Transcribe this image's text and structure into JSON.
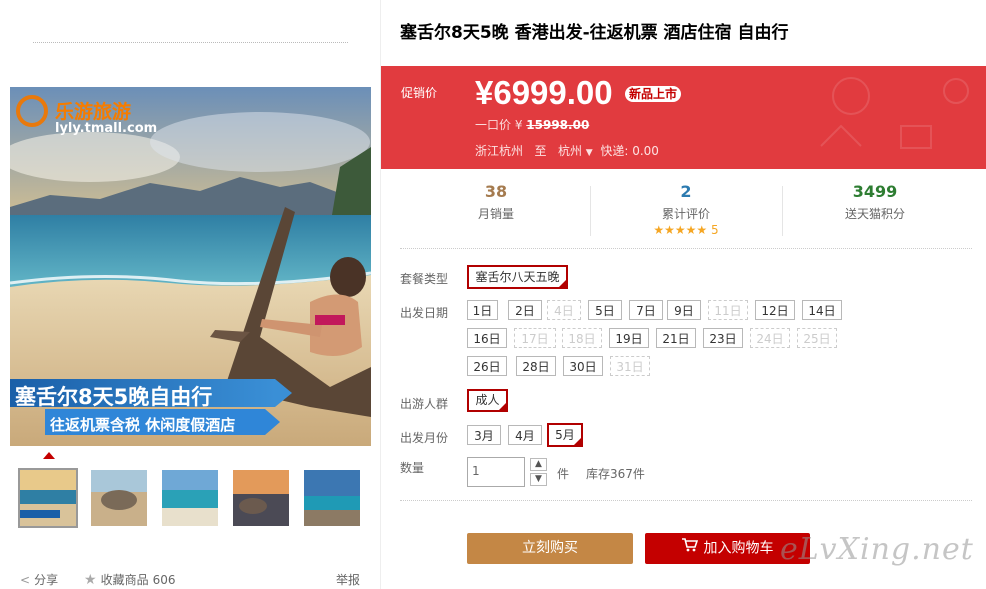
{
  "product": {
    "title": "塞舌尔8天5晚 香港出发-往返机票 酒店住宿 自由行"
  },
  "gallery": {
    "logo_brand": "乐游旅游",
    "logo_url_text": "lyly.tmall.com",
    "banner_title": "塞舌尔8天5晚自由行",
    "banner_sub": "往返机票含税 休闲度假酒店"
  },
  "actions": {
    "share_label": "分享",
    "fav_label": "收藏商品",
    "fav_count": "606",
    "report_label": "举报"
  },
  "price": {
    "promo_label": "促销价",
    "promo_value": "¥6999.00",
    "badge": "新品上市",
    "one_price_label": "一口价 ¥",
    "one_price_value": "15998.00",
    "origin": "浙江杭州",
    "to_label": "至",
    "dest": "杭州",
    "shipping": "快递: 0.00"
  },
  "stats": {
    "monthly_sales": "38",
    "monthly_sales_label": "月销量",
    "reviews": "2",
    "reviews_label": "累计评价",
    "rating_stars": "★★★★★",
    "rating": "5",
    "points": "3499",
    "points_label": "送天猫积分"
  },
  "options": {
    "package_label": "套餐类型",
    "package_value": "塞舌尔八天五晚",
    "date_label": "出发日期",
    "dates": [
      "1日",
      "2日",
      "4日",
      "5日",
      "7日",
      "9日",
      "11日",
      "12日",
      "14日",
      "16日",
      "17日",
      "18日",
      "19日",
      "21日",
      "23日",
      "24日",
      "25日",
      "26日",
      "28日",
      "30日",
      "31日"
    ],
    "group_label": "出游人群",
    "group_value": "成人",
    "month_label": "出发月份",
    "months": [
      "3月",
      "4月",
      "5月"
    ],
    "qty_label": "数量",
    "qty_value": "1",
    "qty_unit": "件",
    "stock": "库存367件"
  },
  "buttons": {
    "buy_now": "立刻购买",
    "add_cart": "加入购物车"
  },
  "watermark": "eLvXing.net",
  "colors": {
    "price_bg": "#e13b3f",
    "buy_btn": "#c48745",
    "cart_btn": "#c40000",
    "selected_border": "#b10000",
    "sales_color": "#a57b4f",
    "reviews_color": "#2c7bb0",
    "points_color": "#2e7d32"
  }
}
